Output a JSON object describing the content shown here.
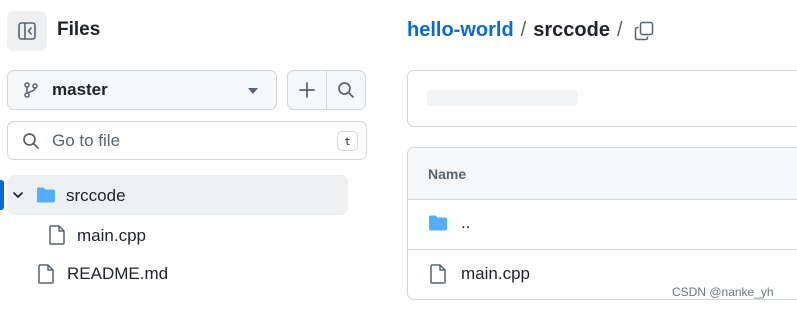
{
  "sidebar": {
    "title": "Files",
    "branch": "master",
    "search_placeholder": "Go to file",
    "search_shortcut": "t",
    "tree": [
      {
        "label": "srccode",
        "type": "folder",
        "expanded": true,
        "selected": true
      },
      {
        "label": "main.cpp",
        "type": "file"
      },
      {
        "label": "README.md",
        "type": "file"
      }
    ]
  },
  "breadcrumb": {
    "repo": "hello-world",
    "separator": "/",
    "folder": "srccode",
    "trailing": "/"
  },
  "file_table": {
    "header": "Name",
    "rows": [
      {
        "label": "..",
        "type": "folder"
      },
      {
        "label": "main.cpp",
        "type": "file"
      }
    ]
  },
  "watermark": "CSDN @nanke_yh",
  "colors": {
    "accent": "#0969da",
    "folder": "#54aeff",
    "border": "#d0d7de",
    "muted_bg": "#f6f8fa",
    "active_bg": "#eef0f2"
  },
  "icons": {
    "panel_toggle": "sidebar-collapse-icon",
    "branch": "git-branch-icon",
    "caret": "triangle-down-icon",
    "add": "plus-icon",
    "search": "search-icon",
    "copy": "copy-icon",
    "chevron": "chevron-down-icon",
    "folder": "folder-icon",
    "file": "file-icon"
  }
}
